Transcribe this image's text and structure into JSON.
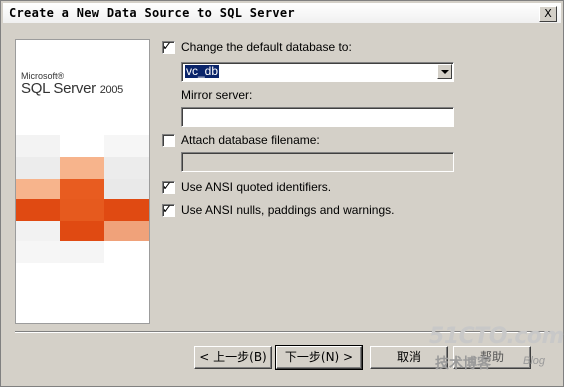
{
  "window": {
    "title": "Create a New Data Source to SQL Server",
    "close_glyph": "X"
  },
  "banner": {
    "brand_small": "Microsoft®",
    "brand_product": "SQL Server",
    "brand_version": "2005"
  },
  "options": {
    "change_default_db": {
      "label": "Change the default database to:",
      "checked": true
    },
    "database_value": "vc_db",
    "mirror_server": {
      "label": "Mirror server:",
      "value": ""
    },
    "attach_db": {
      "label": "Attach database filename:",
      "checked": false,
      "value": ""
    },
    "ansi_quoted": {
      "label": "Use ANSI quoted identifiers.",
      "checked": true
    },
    "ansi_nulls": {
      "label": "Use ANSI nulls, paddings and warnings.",
      "checked": true
    }
  },
  "buttons": {
    "back": "< 上一步(B)",
    "next": "下一步(N) >",
    "cancel": "取消",
    "help": "帮助"
  },
  "watermark": {
    "site": "51CTO.com",
    "tagline": "技术博客",
    "blog": "Blog"
  },
  "colors": {
    "dialog_bg": "#d4d0c8",
    "selection": "#0a246a",
    "orange_dark": "#e04a12",
    "orange_mid": "#f07a3c",
    "orange_light": "#f7b48c"
  }
}
